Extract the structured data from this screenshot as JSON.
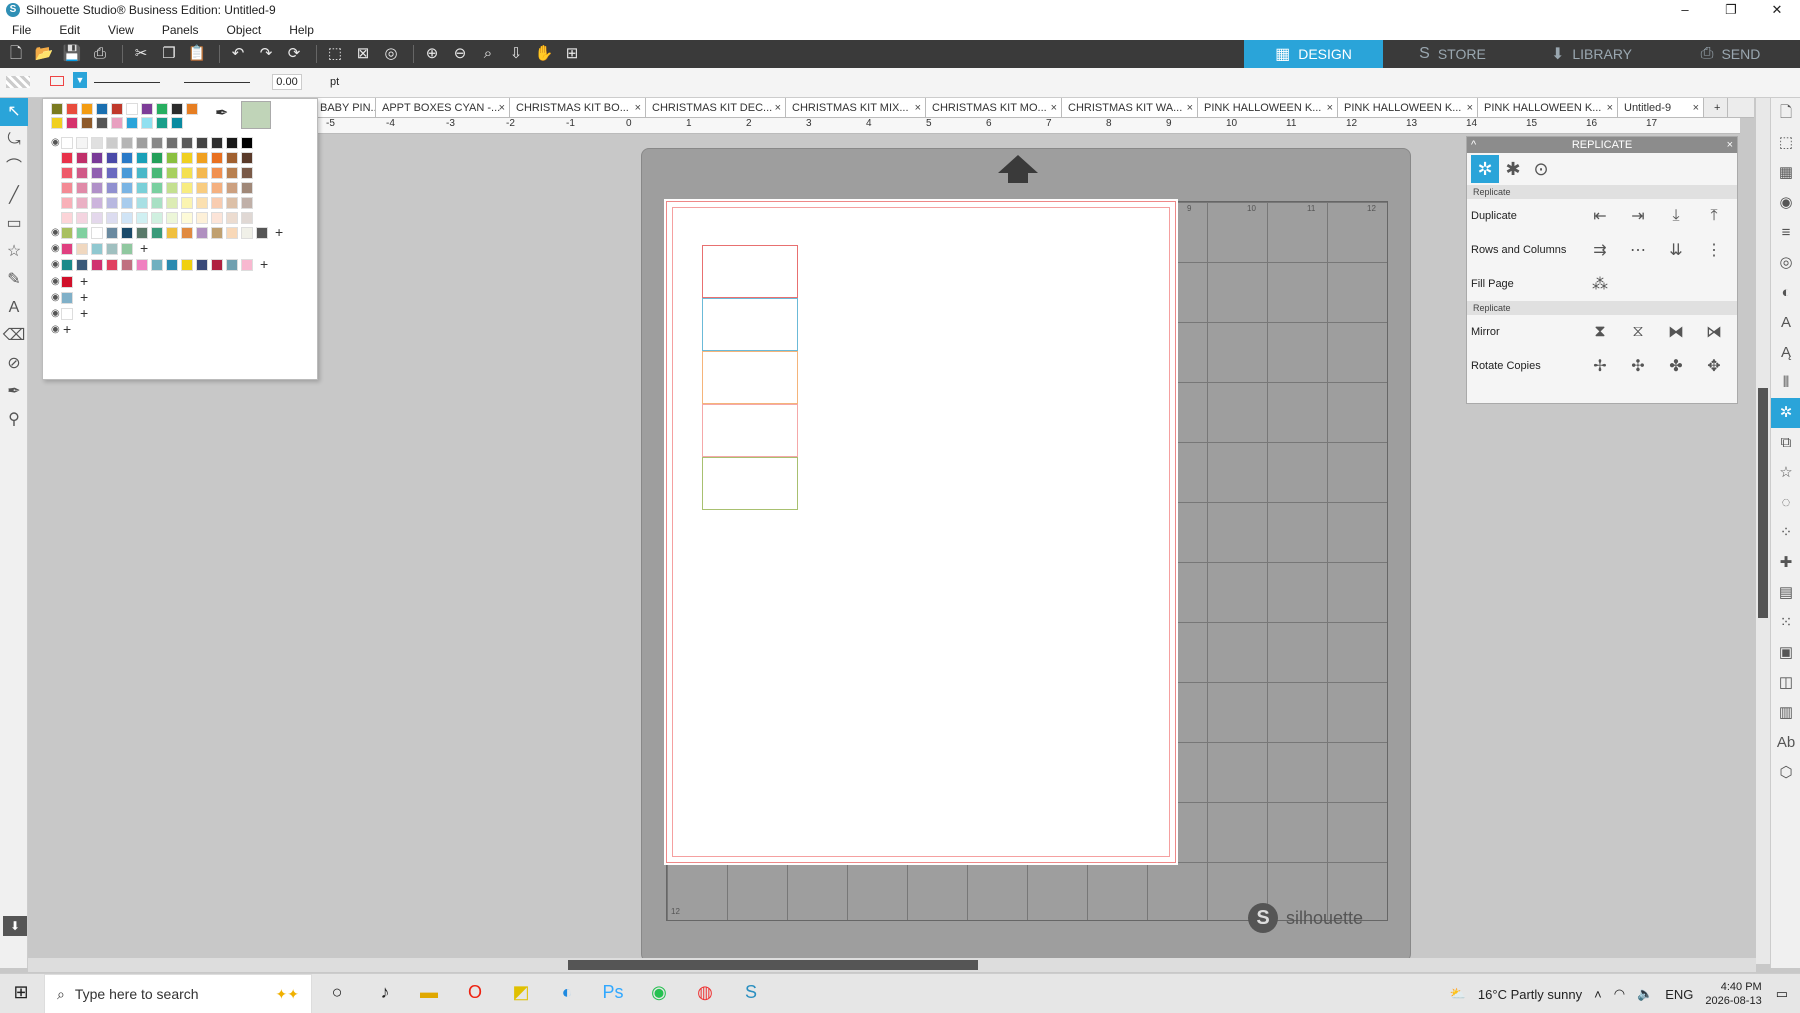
{
  "app": {
    "title": "Silhouette Studio® Business Edition: Untitled-9",
    "icon": "S"
  },
  "window_controls": {
    "minimize": "–",
    "restore": "❐",
    "close": "✕"
  },
  "menu": [
    "File",
    "Edit",
    "View",
    "Panels",
    "Object",
    "Help"
  ],
  "nav": [
    {
      "label": "DESIGN",
      "icon": "▦",
      "active": true
    },
    {
      "label": "STORE",
      "icon": "S",
      "active": false
    },
    {
      "label": "LIBRARY",
      "icon": "⬇",
      "active": false
    },
    {
      "label": "SEND",
      "icon": "⎙",
      "active": false
    }
  ],
  "options": {
    "line_width": "0.00",
    "unit": "pt"
  },
  "tabs": [
    "BABY PIN...",
    "APPT BOXES CYAN -...",
    "CHRISTMAS KIT BO...",
    "CHRISTMAS KIT DEC...",
    "CHRISTMAS KIT MIX...",
    "CHRISTMAS KIT MO...",
    "CHRISTMAS KIT WA...",
    "PINK HALLOWEEN K...",
    "PINK HALLOWEEN K...",
    "PINK HALLOWEEN K...",
    "Untitled-9"
  ],
  "ruler_labels": [
    "-5",
    "-4",
    "-3",
    "-2",
    "-1",
    "0",
    "1",
    "2",
    "3",
    "4",
    "5",
    "6",
    "7",
    "8",
    "9",
    "10",
    "11",
    "12",
    "13",
    "14",
    "15",
    "16",
    "17"
  ],
  "mat_labels": {
    "top_right": [
      "9",
      "10",
      "11",
      "12"
    ],
    "bottom_left": "12"
  },
  "rect_colors": [
    "#e87070",
    "#6bbad8",
    "#f5b47a",
    "#f5a8a8",
    "#a8c070"
  ],
  "brand": "silhouette",
  "replicate": {
    "title": "REPLICATE",
    "section1": "Replicate",
    "rows1": [
      "Duplicate",
      "Rows and Columns",
      "Fill Page"
    ],
    "section2": "Replicate",
    "rows2": [
      "Mirror",
      "Rotate Copies"
    ]
  },
  "taskbar": {
    "search_placeholder": "Type here to search",
    "weather": "16°C  Partly sunny",
    "lang": "ENG",
    "time": "4:40 PM",
    "date": "2026-08-13"
  }
}
